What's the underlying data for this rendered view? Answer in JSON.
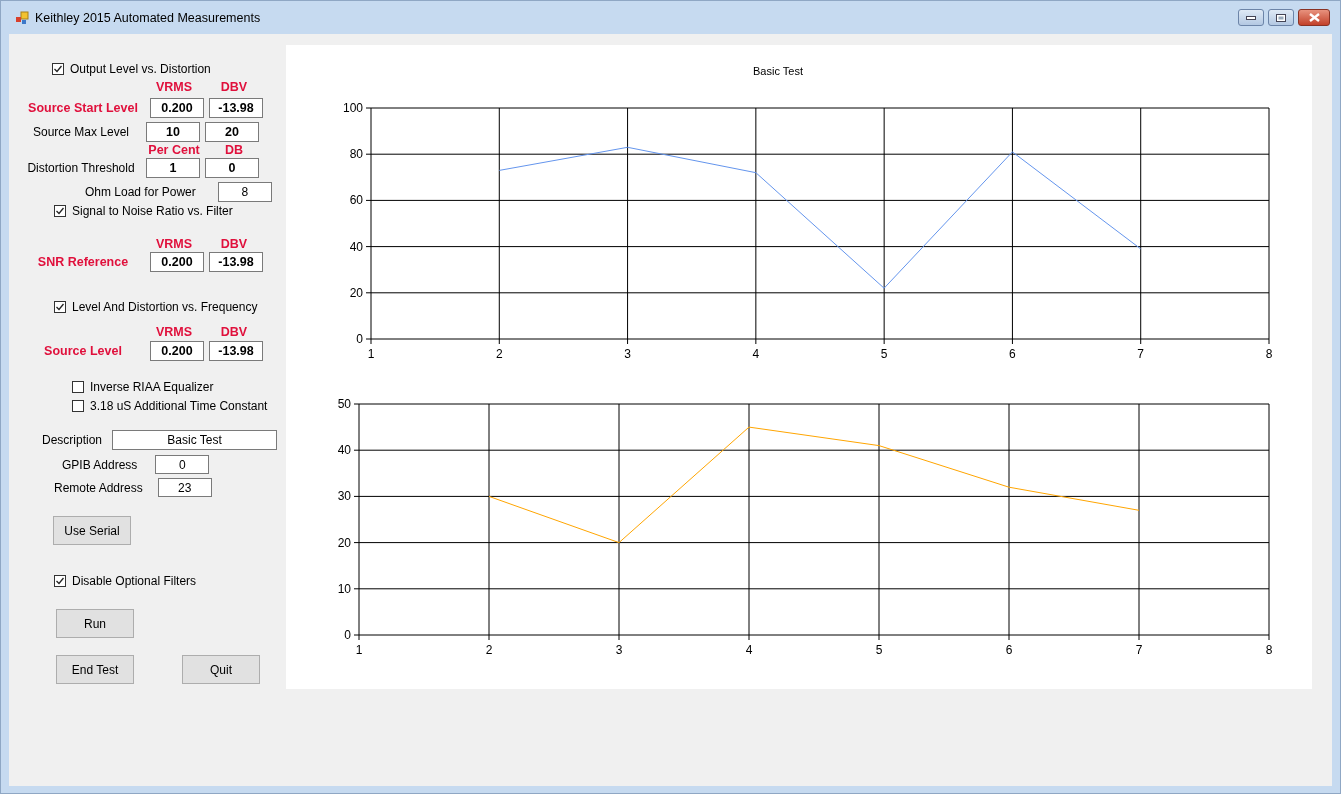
{
  "window": {
    "title": "Keithley 2015 Automated Measurements"
  },
  "controls": [
    {
      "kind": "checkbox",
      "label": "Output Level vs. Distortion",
      "checked": true
    },
    {
      "kind": "units",
      "labels": [
        "VRMS",
        "DBV"
      ]
    },
    {
      "kind": "fields",
      "label": "Source Start Level",
      "emphasis": true,
      "values": [
        "0.200",
        "-13.98"
      ]
    },
    {
      "kind": "fields",
      "label": "Source Max Level",
      "emphasis": false,
      "values": [
        "10",
        "20"
      ]
    },
    {
      "kind": "units",
      "labels": [
        "Per Cent",
        "DB"
      ]
    },
    {
      "kind": "fields",
      "label": "Distortion Threshold",
      "emphasis": false,
      "values": [
        "1",
        "0"
      ]
    },
    {
      "kind": "field",
      "label": "Ohm Load for Power",
      "value": "8"
    },
    {
      "kind": "checkbox",
      "label": "Signal to Noise Ratio vs. Filter",
      "checked": true
    },
    {
      "kind": "units",
      "labels": [
        "VRMS",
        "DBV"
      ]
    },
    {
      "kind": "fields",
      "label": "SNR Reference",
      "emphasis": true,
      "values": [
        "0.200",
        "-13.98"
      ]
    },
    {
      "kind": "checkbox",
      "label": "Level And Distortion vs. Frequency",
      "checked": true
    },
    {
      "kind": "units",
      "labels": [
        "VRMS",
        "DBV"
      ]
    },
    {
      "kind": "fields",
      "label": "Source Level",
      "emphasis": true,
      "values": [
        "0.200",
        "-13.98"
      ]
    },
    {
      "kind": "checkbox",
      "label": "Inverse RIAA Equalizer",
      "checked": false
    },
    {
      "kind": "checkbox",
      "label": "3.18 uS Additional Time Constant",
      "checked": false
    },
    {
      "kind": "entry",
      "label": "Description",
      "value": "Basic Test"
    },
    {
      "kind": "entry",
      "label": "GPIB Address",
      "value": "0"
    },
    {
      "kind": "entry",
      "label": "Remote Address",
      "value": "23"
    },
    {
      "kind": "buttons",
      "labels": [
        "Use Serial"
      ]
    },
    {
      "kind": "checkbox",
      "label": "Disable Optional Filters",
      "checked": true
    },
    {
      "kind": "buttons",
      "labels": [
        "Run"
      ]
    },
    {
      "kind": "buttons",
      "labels": [
        "End Test",
        "Quit"
      ]
    }
  ],
  "charts": [
    {
      "chart_data": {
        "type": "line",
        "title": "Basic Test",
        "x": [
          2,
          3,
          4,
          5,
          6,
          7
        ],
        "series": [
          {
            "color": "#6495ed",
            "values": [
              73,
              83,
              72,
              22,
              81,
              39
            ]
          }
        ],
        "xlim": [
          1,
          8
        ],
        "ylim": [
          0,
          100
        ],
        "xticks": [
          1,
          2,
          3,
          4,
          5,
          6,
          7,
          8
        ],
        "yticks": [
          0,
          20,
          40,
          60,
          80,
          100
        ],
        "grid": true
      }
    },
    {
      "chart_data": {
        "type": "line",
        "x": [
          2,
          3,
          4,
          5,
          6,
          7
        ],
        "series": [
          {
            "color": "#ffa500",
            "values": [
              30,
              20,
              45,
              41,
              32,
              27
            ]
          }
        ],
        "xlim": [
          1,
          8
        ],
        "ylim": [
          0,
          50
        ],
        "xticks": [
          1,
          2,
          3,
          4,
          5,
          6,
          7,
          8
        ],
        "yticks": [
          0,
          10,
          20,
          30,
          40,
          50
        ],
        "grid": true
      }
    }
  ]
}
